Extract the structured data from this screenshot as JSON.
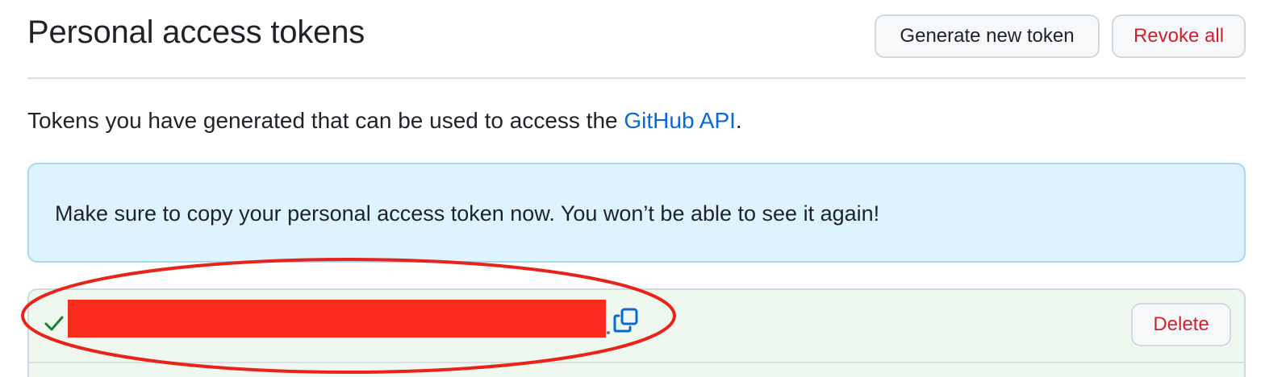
{
  "header": {
    "title": "Personal access tokens",
    "generate_button_label": "Generate new token",
    "revoke_button_label": "Revoke all"
  },
  "intro": {
    "text_before_link": "Tokens you have generated that can be used to access the ",
    "link_text": "GitHub API",
    "text_after_link": "."
  },
  "flash": {
    "message": "Make sure to copy your personal access token now. You won’t be able to see it again!"
  },
  "token": {
    "value": "",
    "status_icon": "check-icon",
    "copy_icon": "copy-icon",
    "delete_button_label": "Delete",
    "redaction_color": "#fb2c1f"
  },
  "colors": {
    "danger": "#cf222e",
    "link": "#0969da",
    "success": "#1a7f37",
    "flash_bg": "#ddf4ff",
    "token_bg": "#eff8ef",
    "annotation": "#e8231a"
  }
}
